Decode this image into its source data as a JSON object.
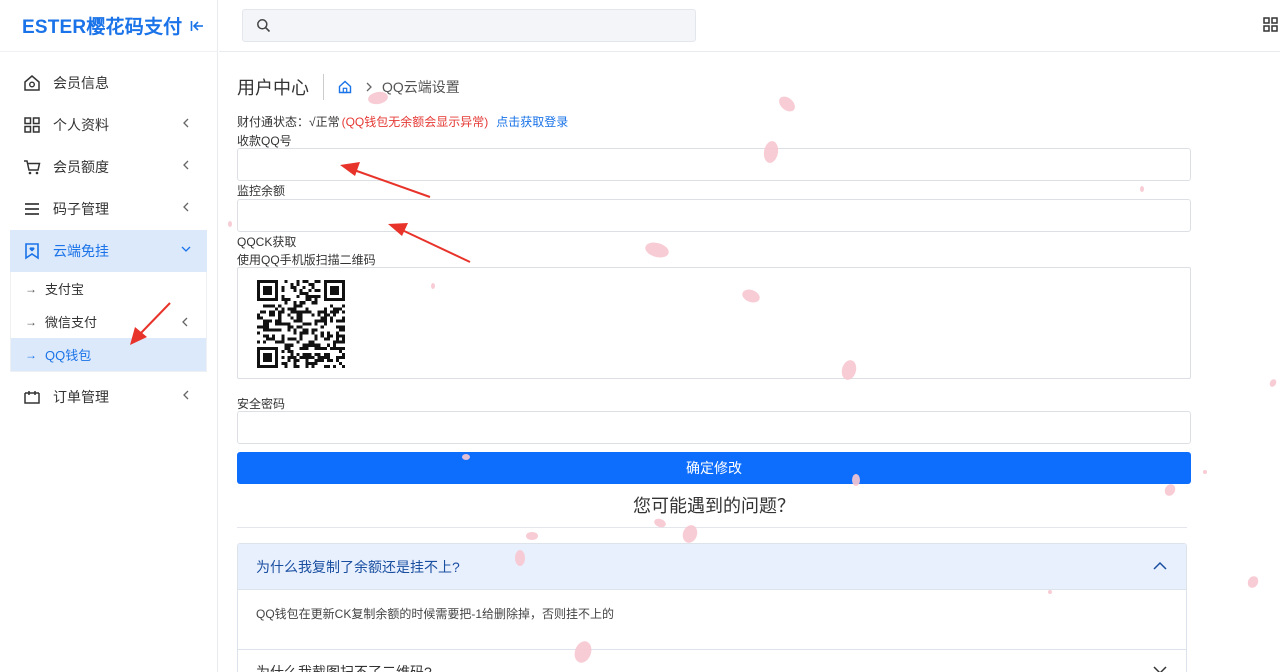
{
  "brand": {
    "title": "ESTER樱花码支付"
  },
  "search": {
    "placeholder": ""
  },
  "sidebar": {
    "items": [
      {
        "label": "会员信息"
      },
      {
        "label": "个人资料"
      },
      {
        "label": "会员额度"
      },
      {
        "label": "码子管理"
      },
      {
        "label": "云端免挂"
      },
      {
        "label": "订单管理"
      }
    ],
    "sub_items": [
      {
        "label": "支付宝"
      },
      {
        "label": "微信支付"
      },
      {
        "label": "QQ钱包"
      }
    ]
  },
  "breadcrumb": {
    "title": "用户中心",
    "current": "QQ云端设置"
  },
  "status": {
    "label": "财付通状态：√正常",
    "warning": "(QQ钱包无余额会显示异常)",
    "link": "点击获取登录"
  },
  "form": {
    "qq_label": "收款QQ号",
    "qq_value": "",
    "balance_label": "监控余额",
    "balance_value": "",
    "qqck_label": "QQCK获取",
    "qr_hint": "使用QQ手机版扫描二维码",
    "password_label": "安全密码",
    "password_value": "",
    "submit_label": "确定修改"
  },
  "faq": {
    "heading": "您可能遇到的问题？",
    "items": [
      {
        "question": "为什么我复制了余额还是挂不上?",
        "answer": "QQ钱包在更新CK复制余额的时候需要把-1给删除掉，否则挂不上的",
        "expanded": true
      },
      {
        "question": "为什么我截图扫不了二维码?",
        "expanded": false
      }
    ]
  },
  "colors": {
    "accent": "#1a73e8",
    "primary_button": "#0d6efd",
    "warning": "#e53935",
    "annotation_arrow": "#e8332a",
    "petal": "#f7c6d0"
  }
}
